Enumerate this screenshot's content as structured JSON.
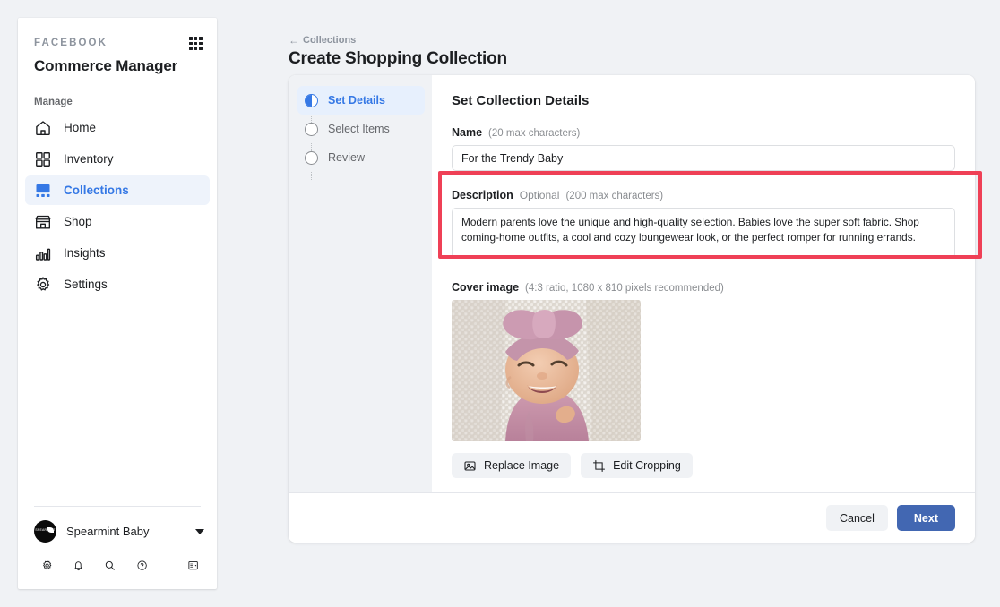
{
  "sidebar": {
    "brand": "FACEBOOK",
    "app_title": "Commerce Manager",
    "grid_icon": "app-grid-icon",
    "section_label": "Manage",
    "items": [
      {
        "label": "Home",
        "icon": "home-icon",
        "active": false
      },
      {
        "label": "Inventory",
        "icon": "inventory-grid-icon",
        "active": false
      },
      {
        "label": "Collections",
        "icon": "collections-icon",
        "active": true
      },
      {
        "label": "Shop",
        "icon": "storefront-icon",
        "active": false
      },
      {
        "label": "Insights",
        "icon": "bar-chart-icon",
        "active": false
      },
      {
        "label": "Settings",
        "icon": "gear-icon",
        "active": false
      }
    ],
    "account": {
      "name": "Spearmint Baby",
      "avatar_text": "SPEARMINT",
      "caret": "chevron-down-icon"
    },
    "tools": [
      "gear-icon",
      "bell-icon",
      "search-icon",
      "help-icon",
      "panel-toggle-icon"
    ]
  },
  "header": {
    "breadcrumb_arrow": "←",
    "breadcrumb": "Collections",
    "title": "Create Shopping Collection"
  },
  "steps": [
    {
      "label": "Set Details",
      "state": "active"
    },
    {
      "label": "Select Items",
      "state": "pending"
    },
    {
      "label": "Review",
      "state": "pending"
    }
  ],
  "form": {
    "panel_title": "Set Collection Details",
    "name": {
      "label": "Name",
      "hint": "(20 max characters)",
      "value": "For the Trendy Baby",
      "placeholder": ""
    },
    "description": {
      "label": "Description",
      "optional": "Optional",
      "hint": "(200 max characters)",
      "value": "Modern parents love the unique and high-quality selection. Babies love the super soft fabric. Shop coming-home outfits, a cool and cozy loungewear look, or the perfect romper for running errands.",
      "placeholder": ""
    },
    "cover_image": {
      "label": "Cover image",
      "hint": "(4:3 ratio, 1080 x 810 pixels recommended)",
      "alt": "smiling baby wearing a pink bow headband on a white textured blanket",
      "buttons": [
        {
          "label": "Replace Image",
          "icon": "image-icon"
        },
        {
          "label": "Edit Cropping",
          "icon": "crop-icon"
        }
      ]
    }
  },
  "footer": {
    "cancel_label": "Cancel",
    "next_label": "Next"
  },
  "colors": {
    "accent_blue": "#3578e5",
    "next_button": "#4267b2",
    "highlight_red": "#ef4056",
    "page_bg": "#f0f2f5"
  },
  "annotation": {
    "name": "description-field-highlight"
  }
}
